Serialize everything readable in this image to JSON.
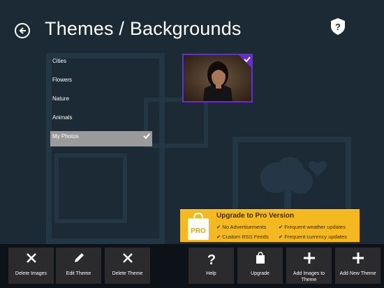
{
  "header": {
    "title": "Themes / Backgrounds"
  },
  "themes": [
    {
      "label": "Cities",
      "selected": false
    },
    {
      "label": "Flowers",
      "selected": false
    },
    {
      "label": "Nature",
      "selected": false
    },
    {
      "label": "Animals",
      "selected": false
    },
    {
      "label": "My Photos",
      "selected": true
    }
  ],
  "thumbnail": {
    "selected": true,
    "accent_color": "#6a2bd1"
  },
  "promo": {
    "title": "Upgrade to Pro Version",
    "badge": "PRO",
    "features": [
      "No Advertisements",
      "Frequent weather updates",
      "Custom RSS Feeds",
      "Frequent currency updates"
    ],
    "background_color": "#f4b821"
  },
  "appbar": {
    "buttons": [
      {
        "label": "Delete Images",
        "icon": "x-icon"
      },
      {
        "label": "Edit Theme",
        "icon": "pencil-icon"
      },
      {
        "label": "Delete Theme",
        "icon": "x-icon"
      },
      {
        "label": "Help",
        "icon": "question-icon"
      },
      {
        "label": "Upgrade",
        "icon": "bag-icon"
      },
      {
        "label": "Add Images to Theme",
        "icon": "plus-icon"
      },
      {
        "label": "Add New Theme",
        "icon": "plus-icon"
      }
    ]
  }
}
